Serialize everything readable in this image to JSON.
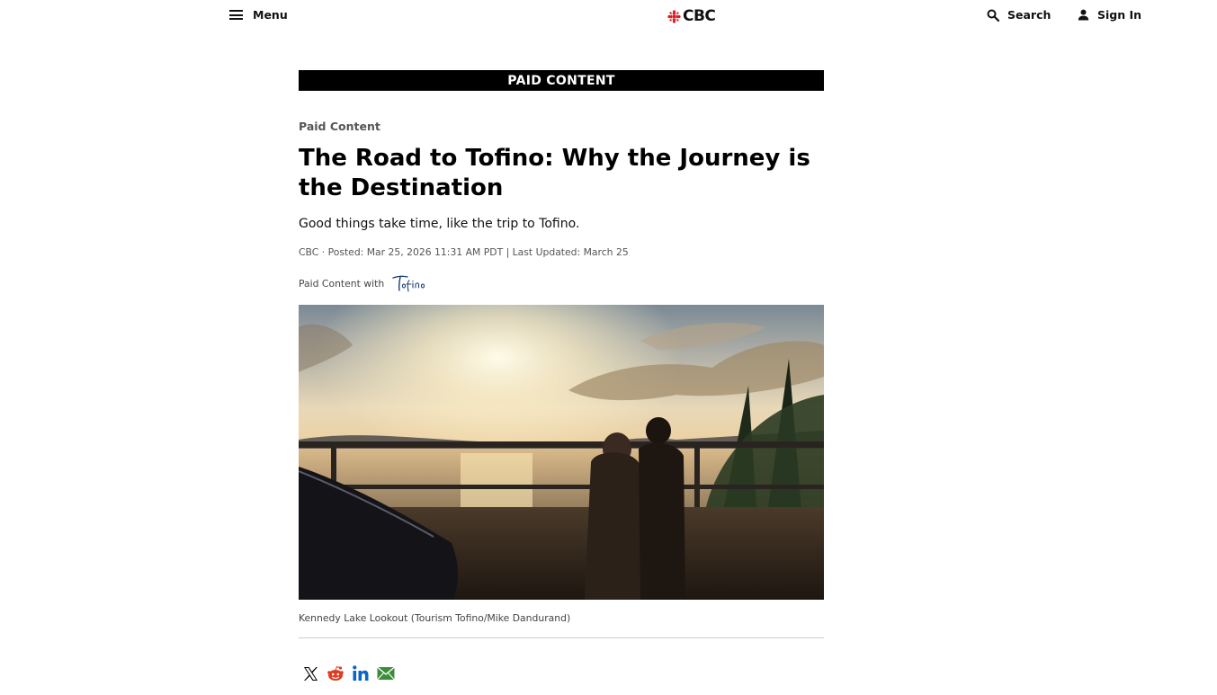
{
  "header": {
    "menu_label": "Menu",
    "logo_text": "CBC",
    "search_label": "Search",
    "signin_label": "Sign In"
  },
  "article": {
    "banner": "PAID CONTENT",
    "kicker": "Paid Content",
    "headline": "The Road to Tofino: Why the Journey is the Destination",
    "deck": "Good things take time, like the trip to Tofino.",
    "byline": "CBC · Posted: Mar 25, 2026 11:31 AM PDT | Last Updated: March 25",
    "sponsor_label": "Paid Content with",
    "sponsor_logo_text": "Tofino",
    "caption": "Kennedy Lake Lookout (Tourism Tofino/Mike Dandurand)"
  },
  "share": [
    {
      "name": "x-icon"
    },
    {
      "name": "reddit-icon"
    },
    {
      "name": "linkedin-icon"
    },
    {
      "name": "email-icon"
    }
  ],
  "colors": {
    "cbc_red": "#d71920",
    "linkedin_blue": "#0a66c2",
    "reddit_red": "#e03c1f",
    "email_green": "#3c8c3c"
  }
}
